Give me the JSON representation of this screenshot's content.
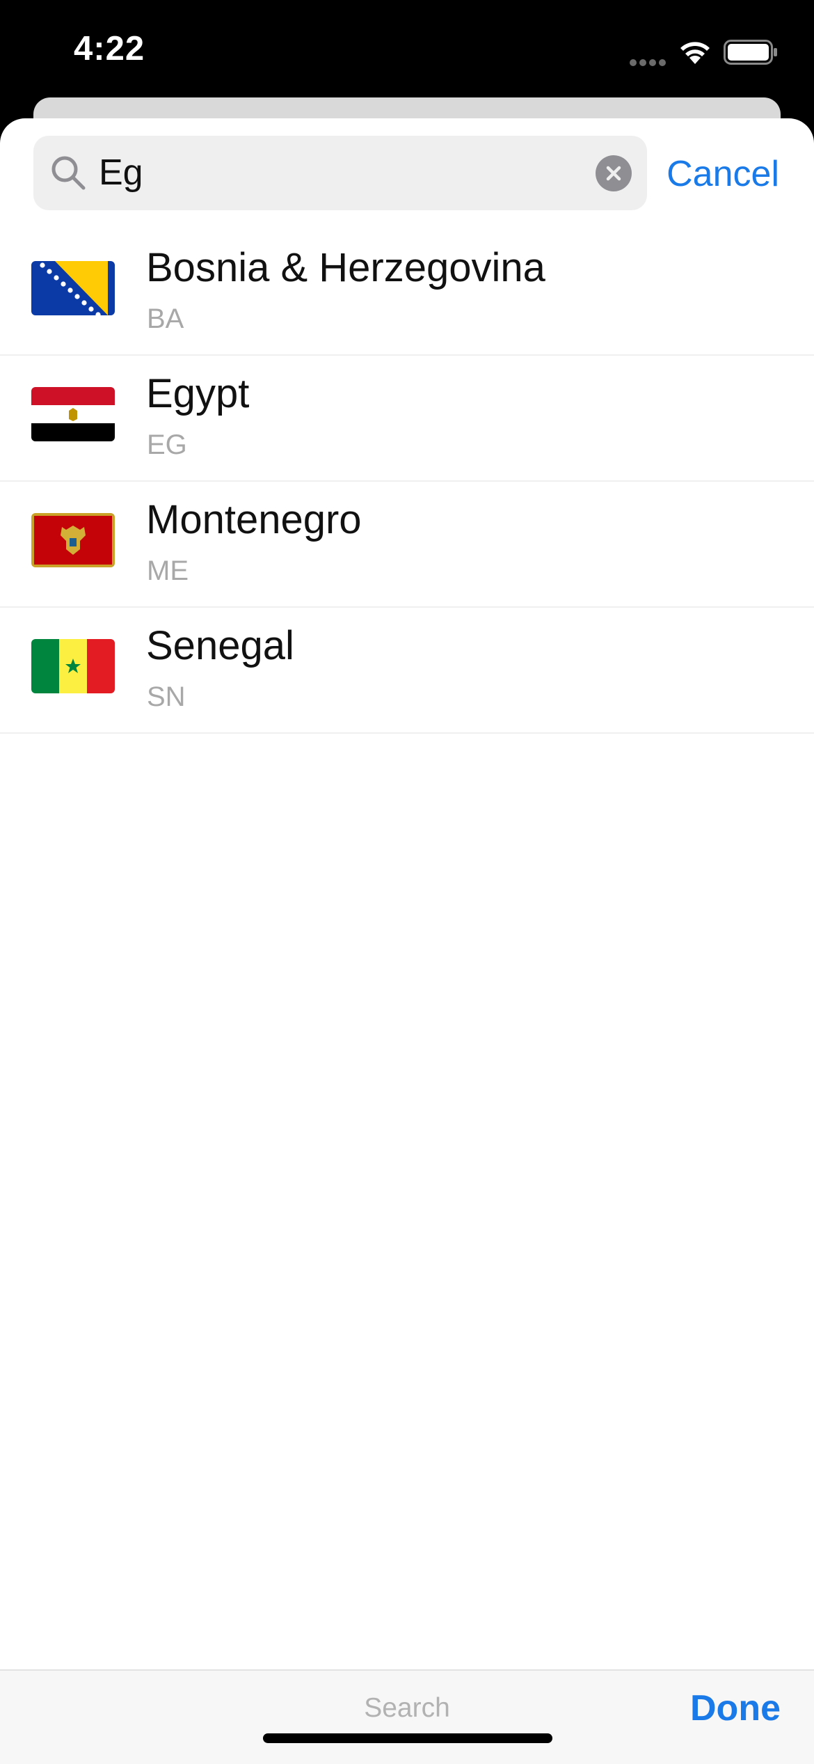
{
  "status_bar": {
    "time": "4:22",
    "icons": [
      "cellular-signal-icon",
      "wifi-icon",
      "battery-icon"
    ]
  },
  "search": {
    "value": "Eg",
    "cancel_label": "Cancel"
  },
  "countries": [
    {
      "name": "Bosnia & Herzegovina",
      "code": "BA",
      "flag_icon": "flag-ba-icon"
    },
    {
      "name": "Egypt",
      "code": "EG",
      "flag_icon": "flag-eg-icon"
    },
    {
      "name": "Montenegro",
      "code": "ME",
      "flag_icon": "flag-me-icon"
    },
    {
      "name": "Senegal",
      "code": "SN",
      "flag_icon": "flag-sn-icon"
    }
  ],
  "toolbar": {
    "search_label": "Search",
    "done_label": "Done"
  },
  "colors": {
    "accent": "#1a7ae8",
    "secondary_text": "#a8a8a8",
    "search_field_bg": "#efefef"
  }
}
